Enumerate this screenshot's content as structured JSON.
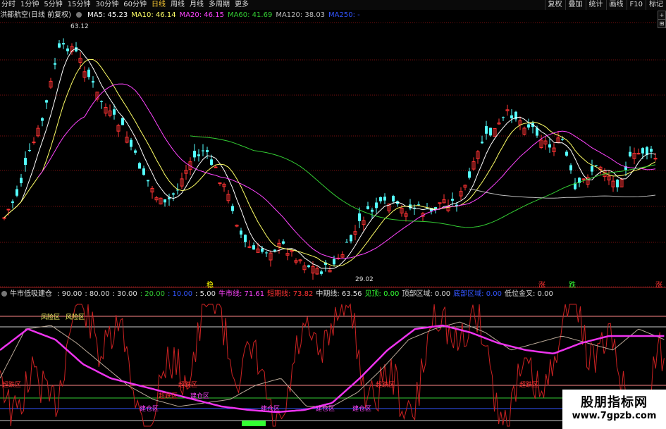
{
  "toolbar": {
    "periods": [
      "分时",
      "1分钟",
      "5分钟",
      "15分钟",
      "30分钟",
      "60分钟",
      "日线",
      "周线",
      "月线",
      "多周期",
      "更多"
    ],
    "active": "日线",
    "right_buttons": [
      "复权",
      "叠加",
      "统计",
      "画线",
      "F10",
      "标记"
    ]
  },
  "main_legend": {
    "title": "洪都航空(日线 前复权)",
    "items": [
      {
        "label": "MA5: 45.23",
        "color": "#ffffff"
      },
      {
        "label": "MA10: 46.14",
        "color": "#ffff66"
      },
      {
        "label": "MA20: 46.15",
        "color": "#ff44ff"
      },
      {
        "label": "MA60: 41.69",
        "color": "#33cc33"
      },
      {
        "label": "MA120: 38.03",
        "color": "#bbbbbb"
      },
      {
        "label": "MA250: -",
        "color": "#3355ff"
      }
    ]
  },
  "price_annotations": {
    "high": "63.12",
    "low": "29.02"
  },
  "signal_labels": [
    {
      "text": "稳",
      "color": "#ffff00"
    },
    {
      "text": "涨",
      "color": "#ff3333"
    },
    {
      "text": "跌",
      "color": "#33ff33"
    },
    {
      "text": "涨",
      "color": "#ff3333"
    }
  ],
  "indicator_legend": {
    "title": "牛市低吸建仓",
    "items": [
      {
        "label": ": 90.00",
        "color": "#dddddd"
      },
      {
        "label": ": 80.00",
        "color": "#dddddd"
      },
      {
        "label": ": 30.00",
        "color": "#dddddd"
      },
      {
        "label": ": 20.00",
        "color": "#33cc33"
      },
      {
        "label": ": 10.00",
        "color": "#3355ff"
      },
      {
        "label": ": 5.00",
        "color": "#dddddd"
      },
      {
        "label": "牛市线: 71.61",
        "color": "#ff44ff"
      },
      {
        "label": "短期线: 73.82",
        "color": "#ff3333"
      },
      {
        "label": "中期线: 63.56",
        "color": "#dddddd"
      },
      {
        "label": "见顶: 0.00",
        "color": "#33ff33"
      },
      {
        "label": "顶部区域: 0.00",
        "color": "#dddddd"
      },
      {
        "label": "底部区域: 0.00",
        "color": "#3355ff"
      },
      {
        "label": "低位金叉: 0.00",
        "color": "#dddddd"
      }
    ]
  },
  "zone_labels": [
    {
      "text": "风险区",
      "color": "#ffff66"
    },
    {
      "text": "风险区",
      "color": "#ffff66"
    },
    {
      "text": "超跌区",
      "color": "#ff3333"
    },
    {
      "text": "超跌区",
      "color": "#ff3333"
    },
    {
      "text": "超跌区",
      "color": "#ff3333"
    },
    {
      "text": "超跌区",
      "color": "#ff3333"
    },
    {
      "text": "超跌区",
      "color": "#ff3333"
    },
    {
      "text": "建仓区",
      "color": "#ff44ff"
    },
    {
      "text": "建仓区",
      "color": "#ff44ff"
    },
    {
      "text": "建仓区",
      "color": "#ff44ff"
    },
    {
      "text": "建仓区",
      "color": "#ff44ff"
    },
    {
      "text": "建仓区",
      "color": "#ff44ff"
    }
  ],
  "watermark": {
    "line1": "股朋指标网",
    "line2": "www.7gpzb.com"
  }
}
